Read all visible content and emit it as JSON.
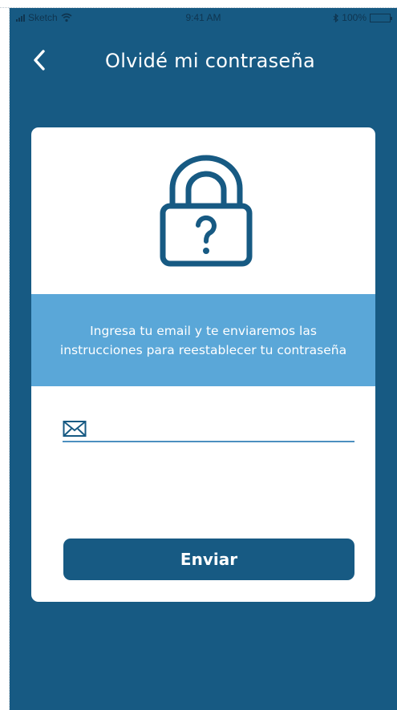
{
  "status_bar": {
    "carrier": "Sketch",
    "time": "9:41 AM",
    "battery": "100%"
  },
  "nav": {
    "title": "Olvidé mi contraseña",
    "back_icon": "chevron-left-icon"
  },
  "card": {
    "illustration_icon": "lock-question-icon",
    "instructions": "Ingresa tu email y te enviaremos las instrucciones para reestablecer tu contraseña",
    "email_field": {
      "icon": "mail-icon",
      "value": "",
      "placeholder": ""
    },
    "submit_label": "Enviar"
  },
  "colors": {
    "background": "#175a83",
    "card": "#ffffff",
    "info_band": "#5aa7d8",
    "button": "#175a83",
    "input_underline": "#4c8fbf"
  }
}
